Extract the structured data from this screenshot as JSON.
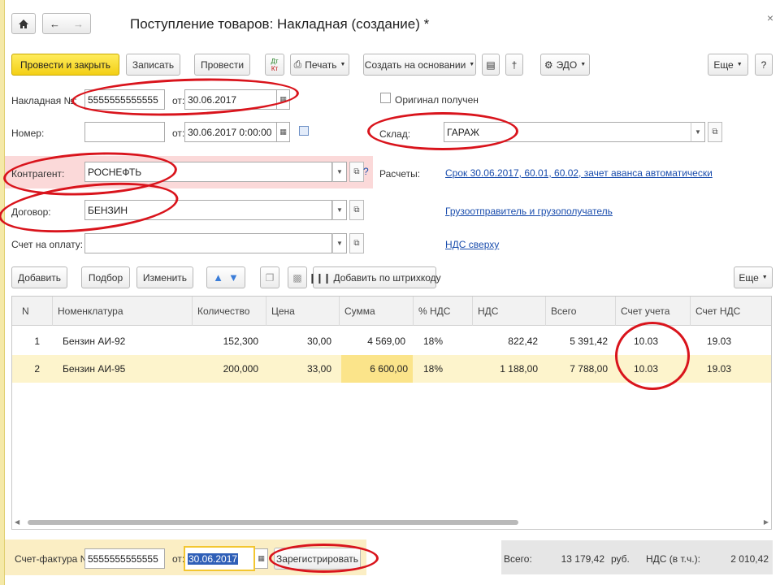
{
  "window": {
    "title": "Поступление товаров: Накладная (создание) *",
    "close_glyph": "×"
  },
  "nav": {
    "home_icon": "home-icon",
    "back_icon": "arrow-left-icon",
    "forward_icon": "arrow-right-icon"
  },
  "toolbar": {
    "post_close": "Провести и закрыть",
    "save": "Записать",
    "post": "Провести",
    "dtkt_top": "Дт",
    "dtkt_bottom": "Кт",
    "print": "Печать",
    "create_based": "Создать на основании",
    "edo": "ЭДО",
    "more": "Еще",
    "help": "?"
  },
  "form": {
    "invoice_label": "Накладная №:",
    "invoice_number": "5555555555555",
    "from_label": "от:",
    "invoice_date": "30.06.2017",
    "original_label": "Оригинал получен",
    "number_label": "Номер:",
    "number_value": "",
    "number_date": "30.06.2017  0:00:00",
    "warehouse_label": "Склад:",
    "warehouse_value": "ГАРАЖ",
    "counterparty_label": "Контрагент:",
    "counterparty_value": "РОСНЕФТЬ",
    "question": "?",
    "settlements_label": "Расчеты:",
    "settlements_link": "Срок 30.06.2017, 60.01, 60.02, зачет аванса автоматически",
    "contract_label": "Договор:",
    "contract_value": "БЕНЗИН",
    "shipper_link": "Грузоотправитель и грузополучатель",
    "invoice_pay_label": "Счет на оплату:",
    "invoice_pay_value": "",
    "vat_link": "НДС сверху"
  },
  "table_toolbar": {
    "add": "Добавить",
    "pick": "Подбор",
    "change": "Изменить",
    "barcode": "Добавить по штрихкоду",
    "more": "Еще"
  },
  "table": {
    "headers": [
      "N",
      "Номенклатура",
      "Количество",
      "Цена",
      "Сумма",
      "% НДС",
      "НДС",
      "Всего",
      "Счет учета",
      "Счет НДС"
    ],
    "rows": [
      [
        "1",
        "Бензин АИ-92",
        "152,300",
        "30,00",
        "4 569,00",
        "18%",
        "822,42",
        "5 391,42",
        "10.03",
        "19.03"
      ],
      [
        "2",
        "Бензин АИ-95",
        "200,000",
        "33,00",
        "6 600,00",
        "18%",
        "1 188,00",
        "7 788,00",
        "10.03",
        "19.03"
      ]
    ]
  },
  "footer": {
    "sf_label": "Счет-фактура №:",
    "sf_number": "5555555555555",
    "sf_from": "от:",
    "sf_date": "30.06.2017",
    "register": "Зарегистрировать",
    "total_label": "Всего:",
    "total_value": "13 179,42",
    "currency": "руб.",
    "vat_label": "НДС (в т.ч.):",
    "vat_value": "2 010,42"
  },
  "colors": {
    "accent_yellow": "#f3cf15",
    "highlight_ring": "#d9141c",
    "selected_row": "#fdf4cc",
    "link": "#1a4dad"
  }
}
